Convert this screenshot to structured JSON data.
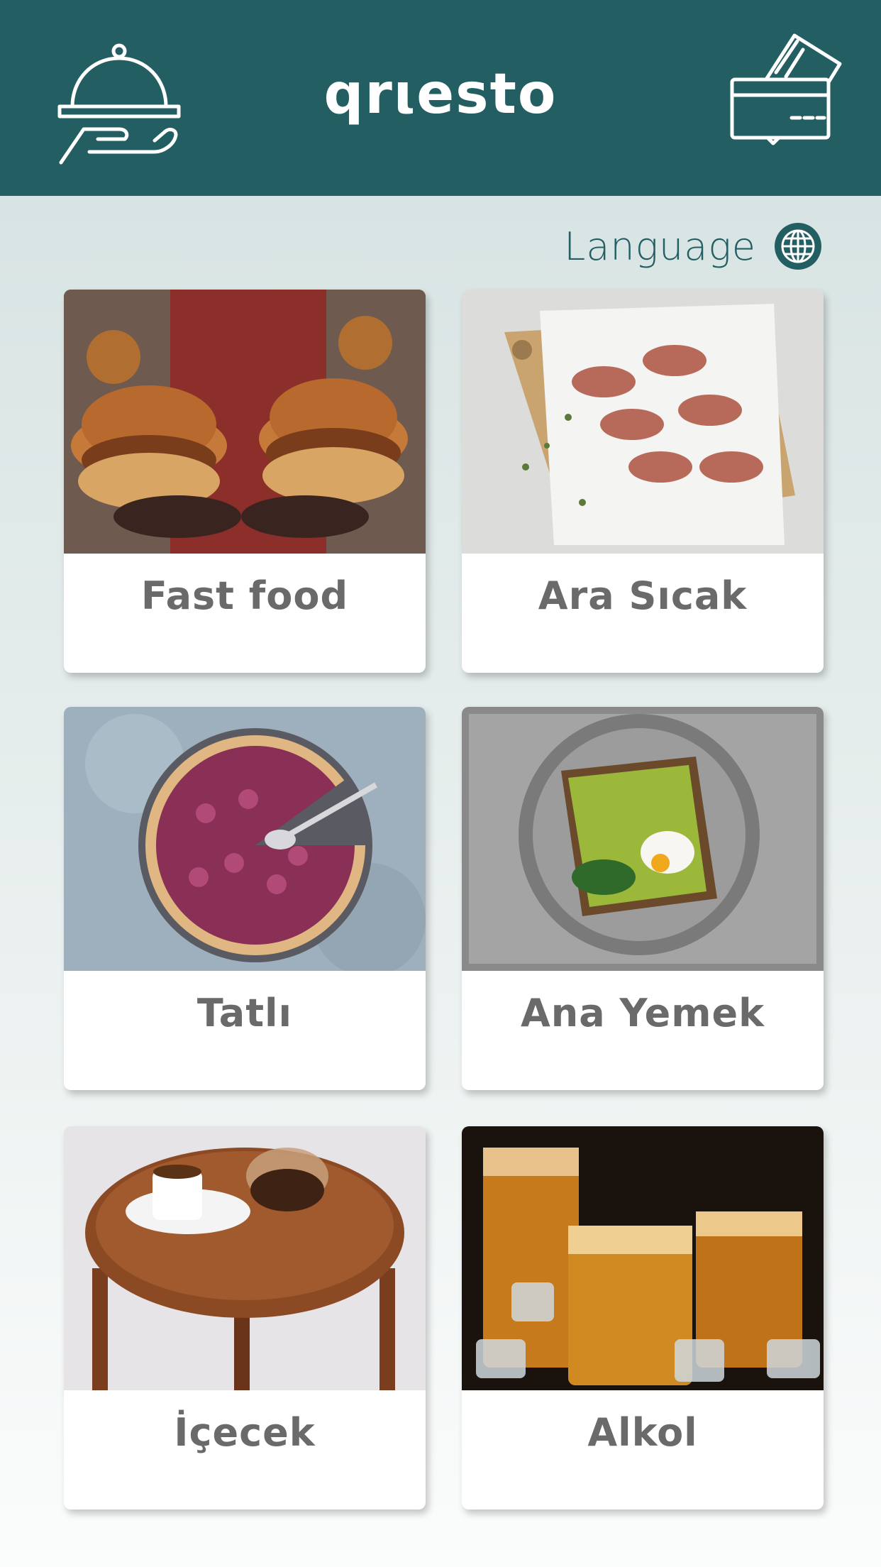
{
  "header": {
    "brand": "qrιesto",
    "waiter_icon": "waiter-cloche-icon",
    "payment_icon": "credit-card-icon",
    "background_color": "#235f62"
  },
  "language": {
    "label": "Language",
    "icon": "globe-icon"
  },
  "categories": [
    {
      "label": "Fast food",
      "image": "burgers-photo"
    },
    {
      "label": "Ara Sıcak",
      "image": "bacon-wraps-photo"
    },
    {
      "label": "Tatlı",
      "image": "raspberry-tart-photo"
    },
    {
      "label": "Ana Yemek",
      "image": "avocado-toast-photo"
    },
    {
      "label": "İçecek",
      "image": "coffee-table-photo"
    },
    {
      "label": "Alkol",
      "image": "whiskey-glasses-photo"
    }
  ],
  "colors": {
    "accent": "#235f62",
    "label_text": "#6a6a6a"
  }
}
